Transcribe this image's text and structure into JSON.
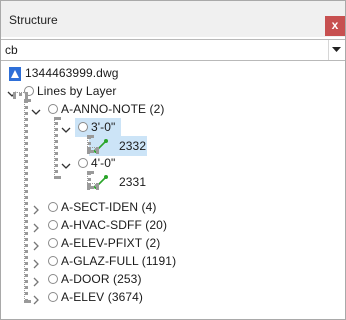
{
  "window": {
    "title": "Structure",
    "close_label": "x"
  },
  "filter": {
    "value": "cb"
  },
  "tree": {
    "file": {
      "label": "1344463999.dwg",
      "icon": "dwg-file-icon"
    },
    "root": {
      "label": "Lines by Layer"
    },
    "layers": [
      {
        "label": "A-ANNO-NOTE (2)",
        "expanded": true
      },
      {
        "label": "A-SECT-IDEN (4)"
      },
      {
        "label": "A-HVAC-SDFF (20)"
      },
      {
        "label": "A-ELEV-PFIXT (2)"
      },
      {
        "label": "A-GLAZ-FULL (1191)"
      },
      {
        "label": "A-DOOR (253)"
      },
      {
        "label": "A-ELEV (3674)"
      }
    ],
    "groups": [
      {
        "label": "3'-0\"",
        "selected": true,
        "item": "2332"
      },
      {
        "label": "4'-0\"",
        "item": "2331"
      }
    ]
  },
  "colors": {
    "selection": "#cce4f7",
    "close": "#c75050",
    "polyline": "#2aa52a",
    "file": "#2e6fd8"
  }
}
